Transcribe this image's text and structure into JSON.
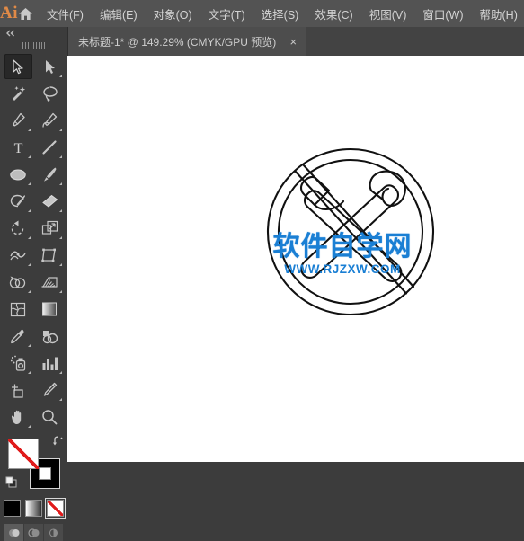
{
  "app": {
    "logo_text": "Ai",
    "home_icon": "home-icon"
  },
  "menubar": {
    "items": [
      {
        "label": "文件(F)",
        "name": "menu-file"
      },
      {
        "label": "编辑(E)",
        "name": "menu-edit"
      },
      {
        "label": "对象(O)",
        "name": "menu-object"
      },
      {
        "label": "文字(T)",
        "name": "menu-type"
      },
      {
        "label": "选择(S)",
        "name": "menu-select"
      },
      {
        "label": "效果(C)",
        "name": "menu-effect"
      },
      {
        "label": "视图(V)",
        "name": "menu-view"
      },
      {
        "label": "窗口(W)",
        "name": "menu-window"
      },
      {
        "label": "帮助(H)",
        "name": "menu-help"
      }
    ]
  },
  "document_tabs": [
    {
      "title": "未标题-1* @ 149.29% (CMYK/GPU 预览)",
      "close_label": "×",
      "active": true,
      "zoom_level": "149.29%",
      "color_mode": "CMYK/GPU 预览"
    }
  ],
  "toolpanel": {
    "collapse_label": "«",
    "tools": [
      {
        "name": "selection-tool",
        "label": "选择工具",
        "active": true,
        "has_flyout": false
      },
      {
        "name": "direct-selection-tool",
        "label": "直接选择工具",
        "active": false,
        "has_flyout": true
      },
      {
        "name": "magic-wand-tool",
        "label": "魔棒工具",
        "active": false,
        "has_flyout": false
      },
      {
        "name": "lasso-tool",
        "label": "套索工具",
        "active": false,
        "has_flyout": false
      },
      {
        "name": "pen-tool",
        "label": "钢笔工具",
        "active": false,
        "has_flyout": true
      },
      {
        "name": "curvature-tool",
        "label": "曲率工具",
        "active": false,
        "has_flyout": true
      },
      {
        "name": "type-tool",
        "label": "文字工具",
        "active": false,
        "has_flyout": true
      },
      {
        "name": "line-segment-tool",
        "label": "直线段工具",
        "active": false,
        "has_flyout": true
      },
      {
        "name": "ellipse-tool",
        "label": "椭圆工具",
        "active": false,
        "has_flyout": true
      },
      {
        "name": "paintbrush-tool",
        "label": "画笔工具",
        "active": false,
        "has_flyout": true
      },
      {
        "name": "shaper-tool",
        "label": "Shaper 工具",
        "active": false,
        "has_flyout": true
      },
      {
        "name": "eraser-tool",
        "label": "橡皮擦工具",
        "active": false,
        "has_flyout": true
      },
      {
        "name": "rotate-tool",
        "label": "旋转工具",
        "active": false,
        "has_flyout": true
      },
      {
        "name": "scale-tool",
        "label": "比例缩放工具",
        "active": false,
        "has_flyout": true
      },
      {
        "name": "width-tool",
        "label": "宽度工具",
        "active": false,
        "has_flyout": true
      },
      {
        "name": "free-transform-tool",
        "label": "自由变换工具",
        "active": false,
        "has_flyout": true
      },
      {
        "name": "shape-builder-tool",
        "label": "形状生成器工具",
        "active": false,
        "has_flyout": true
      },
      {
        "name": "perspective-grid-tool",
        "label": "透视网格工具",
        "active": false,
        "has_flyout": true
      },
      {
        "name": "mesh-tool",
        "label": "网格工具",
        "active": false,
        "has_flyout": false
      },
      {
        "name": "gradient-tool",
        "label": "渐变工具",
        "active": false,
        "has_flyout": false
      },
      {
        "name": "eyedropper-tool",
        "label": "吸管工具",
        "active": false,
        "has_flyout": true
      },
      {
        "name": "blend-tool",
        "label": "混合工具",
        "active": false,
        "has_flyout": false
      },
      {
        "name": "symbol-sprayer-tool",
        "label": "符号喷枪工具",
        "active": false,
        "has_flyout": true
      },
      {
        "name": "column-graph-tool",
        "label": "柱形图工具",
        "active": false,
        "has_flyout": true
      },
      {
        "name": "artboard-tool",
        "label": "画板工具",
        "active": false,
        "has_flyout": false
      },
      {
        "name": "slice-tool",
        "label": "切片工具",
        "active": false,
        "has_flyout": true
      },
      {
        "name": "hand-tool",
        "label": "抓手工具",
        "active": false,
        "has_flyout": true
      },
      {
        "name": "zoom-tool",
        "label": "缩放工具",
        "active": false,
        "has_flyout": false
      }
    ],
    "color_controls": {
      "fill": {
        "name": "fill-swatch",
        "value": "None",
        "color": "#ffffff"
      },
      "stroke": {
        "name": "stroke-swatch",
        "value": "Black",
        "color": "#000000"
      },
      "swap_icon": "swap-fill-stroke-icon",
      "default_icon": "default-fill-stroke-icon",
      "modes": [
        {
          "name": "color-mode-button",
          "label": "颜色",
          "selected": false,
          "color": "#000000"
        },
        {
          "name": "gradient-mode-button",
          "label": "渐变",
          "selected": false
        },
        {
          "name": "none-mode-button",
          "label": "无",
          "selected": true
        }
      ],
      "draw_modes": [
        {
          "name": "draw-normal-button",
          "label": "正常绘图",
          "selected": true
        },
        {
          "name": "draw-behind-button",
          "label": "背面绘图",
          "selected": false
        },
        {
          "name": "draw-inside-button",
          "label": "内部绘图",
          "selected": false
        }
      ]
    }
  },
  "canvas": {
    "background": "#ffffff",
    "artwork_name": "no-mining-tools-sign",
    "watermark": {
      "chinese": "软件自学网",
      "url": "WWW.RJZXW.COM",
      "color": "#1a7fd4"
    }
  },
  "colors": {
    "menubar_bg": "#535353",
    "tabbar_bg": "#434343",
    "tab_active_bg": "#4d4d4d",
    "panel_bg": "#3c3c3c",
    "canvas_bg": "#ffffff",
    "accent_orange": "#e08a47",
    "watermark_blue": "#1a7fd4"
  }
}
